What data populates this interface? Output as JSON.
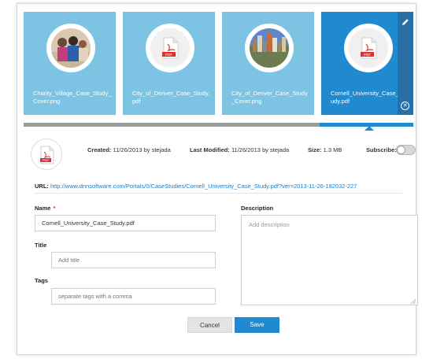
{
  "tiles": [
    {
      "filename": "Charity_Village_Case_Study_Cover.png",
      "thumb": "photo-people"
    },
    {
      "filename": "City_of_Denver_Case_Study.pdf",
      "thumb": "pdf-icon"
    },
    {
      "filename": "City_of_Denver_Case_Study_Cover.png",
      "thumb": "photo-city"
    },
    {
      "filename": "Cornell_University_Case_Study.pdf",
      "thumb": "pdf-icon"
    }
  ],
  "selected_index": 3,
  "scroll_position": 0.24,
  "details": {
    "created_label": "Created:",
    "created_value": "11/26/2013 by stejada",
    "modified_label": "Last Modified:",
    "modified_value": "11/26/2013 by stejada",
    "size_label": "Size:",
    "size_value": "1.3 MB",
    "subscribe_label": "Subscribe:",
    "subscribed": false,
    "url_label": "URL:",
    "url_value": "http://www.dnnsoftware.com/Portals/0/CaseStudies/Cornell_University_Case_Study.pdf?ver=2013-11-26-182032-227"
  },
  "form": {
    "name_label": "Name",
    "name_required": "*",
    "name_value": "Cornell_University_Case_Study.pdf",
    "title_label": "Title",
    "title_placeholder": "Add title",
    "tags_label": "Tags",
    "tags_placeholder": "separate tags with a comma",
    "description_label": "Description",
    "description_placeholder": "Add description"
  },
  "buttons": {
    "cancel": "Cancel",
    "save": "Save"
  },
  "colors": {
    "tile": "#7dc4e4",
    "tile_selected": "#1f8ad0",
    "accent": "#1f8ad0",
    "required": "#e0302d",
    "pdf_red": "#e0302d"
  },
  "icons": {
    "edit": "pencil-icon",
    "close": "close-circle-icon",
    "file": "pdf-file-icon"
  }
}
